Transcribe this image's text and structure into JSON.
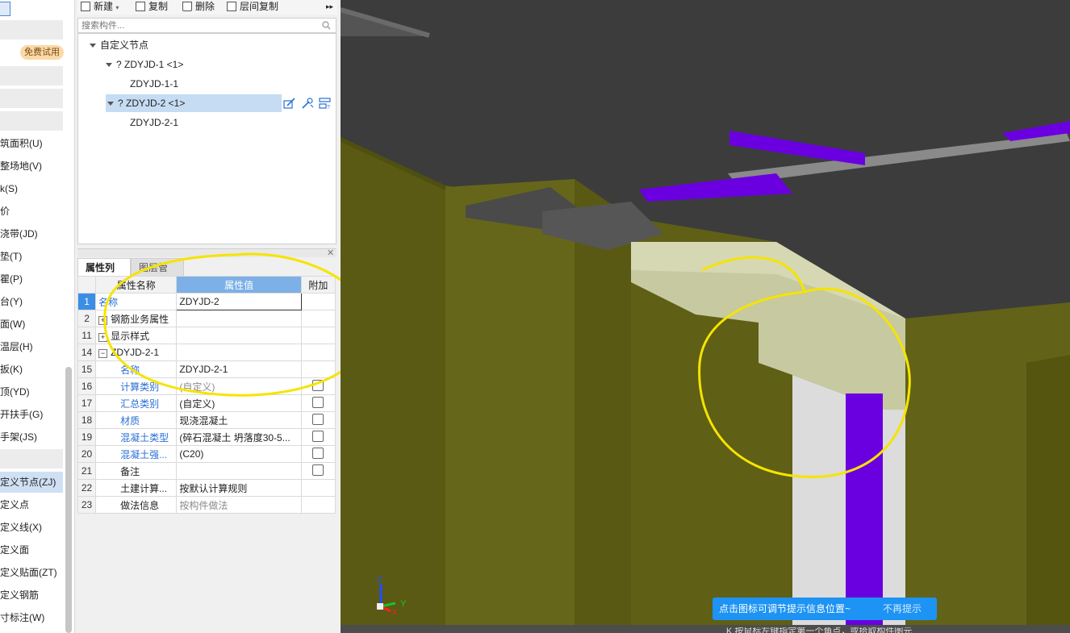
{
  "left_nav": {
    "free_trial": "免费试用",
    "items": [
      "筑面积(U)",
      "整场地(V)",
      "k(S)",
      "价",
      "浇带(JD)",
      "垫(T)",
      "瞿(P)",
      "台(Y)",
      "面(W)",
      "温层(H)",
      "扳(K)",
      "顶(YD)",
      "开扶手(G)",
      "手架(JS)",
      "",
      "定义节点(ZJ)",
      "定义点",
      "定义线(X)",
      "定义面",
      "定义贴面(ZT)",
      "定义钢筋",
      "寸标注(W)"
    ],
    "selected": "定义节点(ZJ)"
  },
  "toolbar": {
    "new": "新建",
    "copy": "复制",
    "delete": "删除",
    "floor_copy": "层间复制",
    "more": "▸▸"
  },
  "search": {
    "placeholder": "搜索构件..."
  },
  "tree": {
    "root": "自定义节点",
    "nodes": [
      {
        "label": "? ZDYJD-1 <1>",
        "child": "ZDYJD-1-1"
      },
      {
        "label": "? ZDYJD-2 <1>",
        "child": "ZDYJD-2-1"
      }
    ]
  },
  "props": {
    "tab_active": "属性列表",
    "tab_other": "图层管理",
    "headers": {
      "name": "属性名称",
      "value": "属性值",
      "extra": "附加"
    },
    "rows": [
      {
        "n": "1",
        "name": "名称",
        "value": "ZDYJD-2"
      },
      {
        "n": "2",
        "name": "钢筋业务属性",
        "value": ""
      },
      {
        "n": "11",
        "name": "显示样式",
        "value": ""
      },
      {
        "n": "14",
        "name": "ZDYJD-2-1",
        "value": ""
      },
      {
        "n": "15",
        "name": "名称",
        "value": "ZDYJD-2-1"
      },
      {
        "n": "16",
        "name": "计算类别",
        "value": "(自定义)"
      },
      {
        "n": "17",
        "name": "汇总类别",
        "value": "(自定义)"
      },
      {
        "n": "18",
        "name": "材质",
        "value": "现浇混凝土"
      },
      {
        "n": "19",
        "name": "混凝土类型",
        "value": "(碎石混凝土 坍落度30-5..."
      },
      {
        "n": "20",
        "name": "混凝土强...",
        "value": "(C20)"
      },
      {
        "n": "21",
        "name": "备注",
        "value": ""
      },
      {
        "n": "22",
        "name": "土建计算...",
        "value": "按默认计算规则"
      },
      {
        "n": "23",
        "name": "做法信息",
        "value": "按构件做法"
      }
    ]
  },
  "viewport": {
    "tip_text": "点击图标可调节提示信息位置~",
    "tip_dismiss": "不再提示",
    "bottom_hint": "K 按鼠标左键指定第一个角点，或拾取构件图元",
    "axis_z": "Z",
    "axis_y": "Y",
    "axis_x": "X"
  },
  "colors": {
    "wall_olive": "#5f5f16",
    "slab_dark": "#3a3a3a",
    "rebar_purple": "#6a00e0",
    "concrete_light": "#c7c9a0",
    "annotation_yellow": "#f5e400",
    "tip_blue": "#1d93f3"
  }
}
